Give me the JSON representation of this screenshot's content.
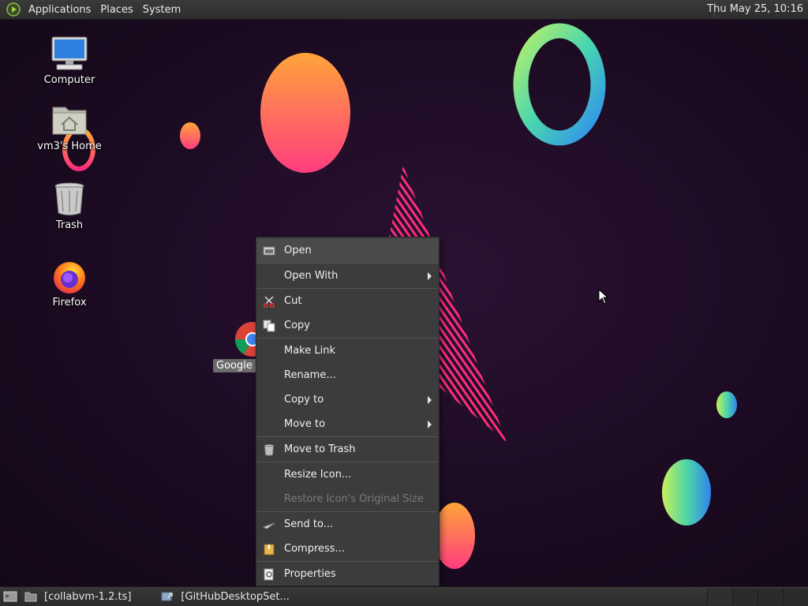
{
  "top_panel": {
    "menus": [
      "Applications",
      "Places",
      "System"
    ],
    "clock": "Thu May 25, 10:16"
  },
  "desktop_icons": [
    {
      "label": "Computer",
      "icon": "computer-icon"
    },
    {
      "label": "vm3's Home",
      "icon": "home-folder-icon"
    },
    {
      "label": "Trash",
      "icon": "trash-icon"
    },
    {
      "label": "Firefox",
      "icon": "firefox-icon"
    }
  ],
  "selected_icon": {
    "label": "Google C",
    "icon": "chrome-icon"
  },
  "context_menu": {
    "items": [
      {
        "label": "Open",
        "icon": "open-icon"
      },
      {
        "label": "Open With",
        "submenu": true
      },
      {
        "label": "Cut",
        "icon": "scissors-icon"
      },
      {
        "label": "Copy",
        "icon": "copy-icon"
      },
      {
        "label": "Make Link"
      },
      {
        "label": "Rename..."
      },
      {
        "label": "Copy to",
        "submenu": true
      },
      {
        "label": "Move to",
        "submenu": true
      },
      {
        "label": "Move to Trash",
        "icon": "trash-icon"
      },
      {
        "label": "Resize Icon..."
      },
      {
        "label": "Restore Icon's Original Size",
        "disabled": true
      },
      {
        "label": "Send to...",
        "icon": "send-icon"
      },
      {
        "label": "Compress...",
        "icon": "archive-icon"
      },
      {
        "label": "Properties",
        "icon": "properties-icon"
      }
    ]
  },
  "taskbar": {
    "tasks": [
      {
        "label": "[collabvm-1.2.ts]",
        "icon": "folder-icon"
      },
      {
        "label": "[GitHubDesktopSet...",
        "icon": "installer-icon"
      }
    ]
  },
  "colors": {
    "panel_bg": "#2d2d2d",
    "menu_bg": "#3c3c3c",
    "wallpaper_bg": "#1d0d22",
    "accent_pink": "#ff2d7a",
    "accent_orange": "#ffa43a"
  }
}
